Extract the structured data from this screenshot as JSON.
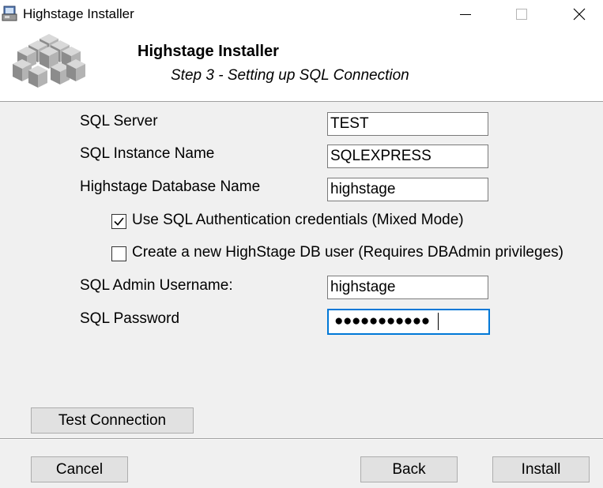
{
  "window": {
    "title": "Highstage Installer",
    "icon": "installer-icon",
    "controls": {
      "minimize": "minimize-icon",
      "maximize": "maximize-icon",
      "close": "close-icon"
    }
  },
  "header": {
    "title": "Highstage Installer",
    "subtitle": "Step 3 - Setting up SQL Connection",
    "logo": "cubes-logo"
  },
  "form": {
    "sql_server": {
      "label": "SQL Server",
      "value": "TEST"
    },
    "sql_instance": {
      "label": "SQL Instance Name",
      "value": "SQLEXPRESS"
    },
    "db_name": {
      "label": "Highstage Database Name",
      "value": "highstage"
    },
    "use_sql_auth": {
      "label": "Use SQL Authentication credentials (Mixed Mode)",
      "checked": true
    },
    "create_db_user": {
      "label": "Create a new HighStage DB user (Requires DBAdmin privileges)",
      "checked": false
    },
    "admin_username": {
      "label": "SQL Admin Username:",
      "value": "highstage"
    },
    "password": {
      "label": "SQL Password",
      "masked_value": "●●●●●●●●●●●"
    }
  },
  "buttons": {
    "test_connection": "Test Connection",
    "cancel": "Cancel",
    "back": "Back",
    "install": "Install"
  },
  "colors": {
    "dialog_bg": "#f0f0f0",
    "header_bg": "#ffffff",
    "focus_border": "#0078d7",
    "button_bg": "#e1e1e1"
  }
}
